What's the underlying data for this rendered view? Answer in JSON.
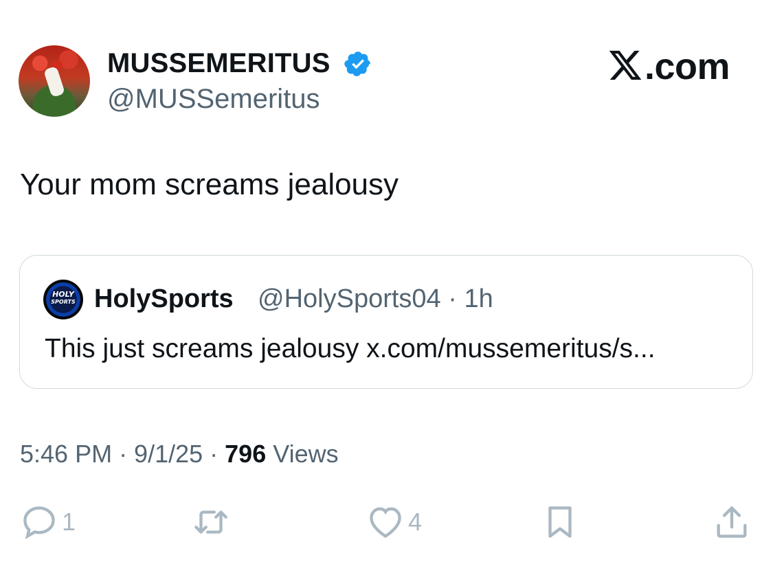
{
  "header": {
    "display_name": "MUSSEMERITUS",
    "handle": "@MUSSemeritus",
    "brand": ".com",
    "brand_prefix": "X"
  },
  "tweet": {
    "text": "Your mom screams jealousy"
  },
  "quote": {
    "avatar_text_line1": "HOLY",
    "avatar_text_line2": "SPORTS",
    "name": "HolySports",
    "handle_time": "@HolySports04 · 1h",
    "text": "This just screams jealousy x.com/mussemeritus/s..."
  },
  "meta": {
    "time_date": "5:46 PM · 9/1/25 · ",
    "views_count": "796",
    "views_label": " Views"
  },
  "actions": {
    "reply_count": "1",
    "like_count": "4"
  },
  "colors": {
    "verified": "#1d9bf0",
    "secondary_text": "#536471",
    "action_icon": "#aab8c2"
  },
  "icons": [
    "verified-badge-icon",
    "reply-icon",
    "retweet-icon",
    "like-icon",
    "bookmark-icon",
    "share-icon"
  ]
}
